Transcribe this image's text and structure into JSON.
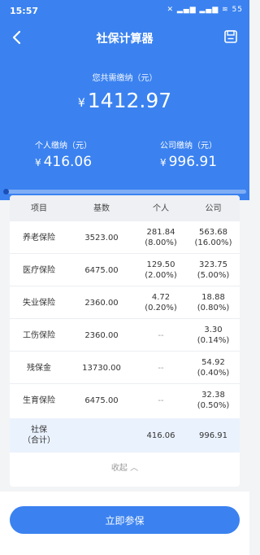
{
  "status": {
    "time": "15:57",
    "icons_text": "✕ ▂▄▆ ▂▄▆ ≋ 55"
  },
  "nav": {
    "title": "社保计算器"
  },
  "summary": {
    "total_label": "您共需缴纳（元）",
    "currency": "¥",
    "total_value": "1412.97",
    "personal_label": "个人缴纳（元）",
    "personal_value": "416.06",
    "company_label": "公司缴纳（元）",
    "company_value": "996.91"
  },
  "table": {
    "headers": [
      "项目",
      "基数",
      "个人",
      "公司"
    ],
    "rows": [
      {
        "item": "养老保险",
        "base": "3523.00",
        "personal": "281.84",
        "personal_rate": "(8.00%)",
        "company": "563.68",
        "company_rate": "(16.00%)"
      },
      {
        "item": "医疗保险",
        "base": "6475.00",
        "personal": "129.50",
        "personal_rate": "(2.00%)",
        "company": "323.75",
        "company_rate": "(5.00%)"
      },
      {
        "item": "失业保险",
        "base": "2360.00",
        "personal": "4.72",
        "personal_rate": "(0.20%)",
        "company": "18.88",
        "company_rate": "(0.80%)"
      },
      {
        "item": "工伤保险",
        "base": "2360.00",
        "personal": "--",
        "personal_rate": "",
        "company": "3.30",
        "company_rate": "(0.14%)"
      },
      {
        "item": "残保金",
        "base": "13730.00",
        "personal": "--",
        "personal_rate": "",
        "company": "54.92",
        "company_rate": "(0.40%)"
      },
      {
        "item": "生育保险",
        "base": "6475.00",
        "personal": "--",
        "personal_rate": "",
        "company": "32.38",
        "company_rate": "(0.50%)"
      }
    ],
    "total": {
      "label_line1": "社保",
      "label_line2": "（合计）",
      "personal": "416.06",
      "company": "996.91"
    },
    "collapse_label": "收起 ︿"
  },
  "cta": {
    "label": "立即参保"
  },
  "colors": {
    "primary": "#3b82f0",
    "card_bg": "#ffffff",
    "page_bg": "#f3f4f6",
    "total_row_bg": "#eaf2fd"
  },
  "icons": {
    "back": "back-arrow-icon",
    "save": "save-icon"
  }
}
